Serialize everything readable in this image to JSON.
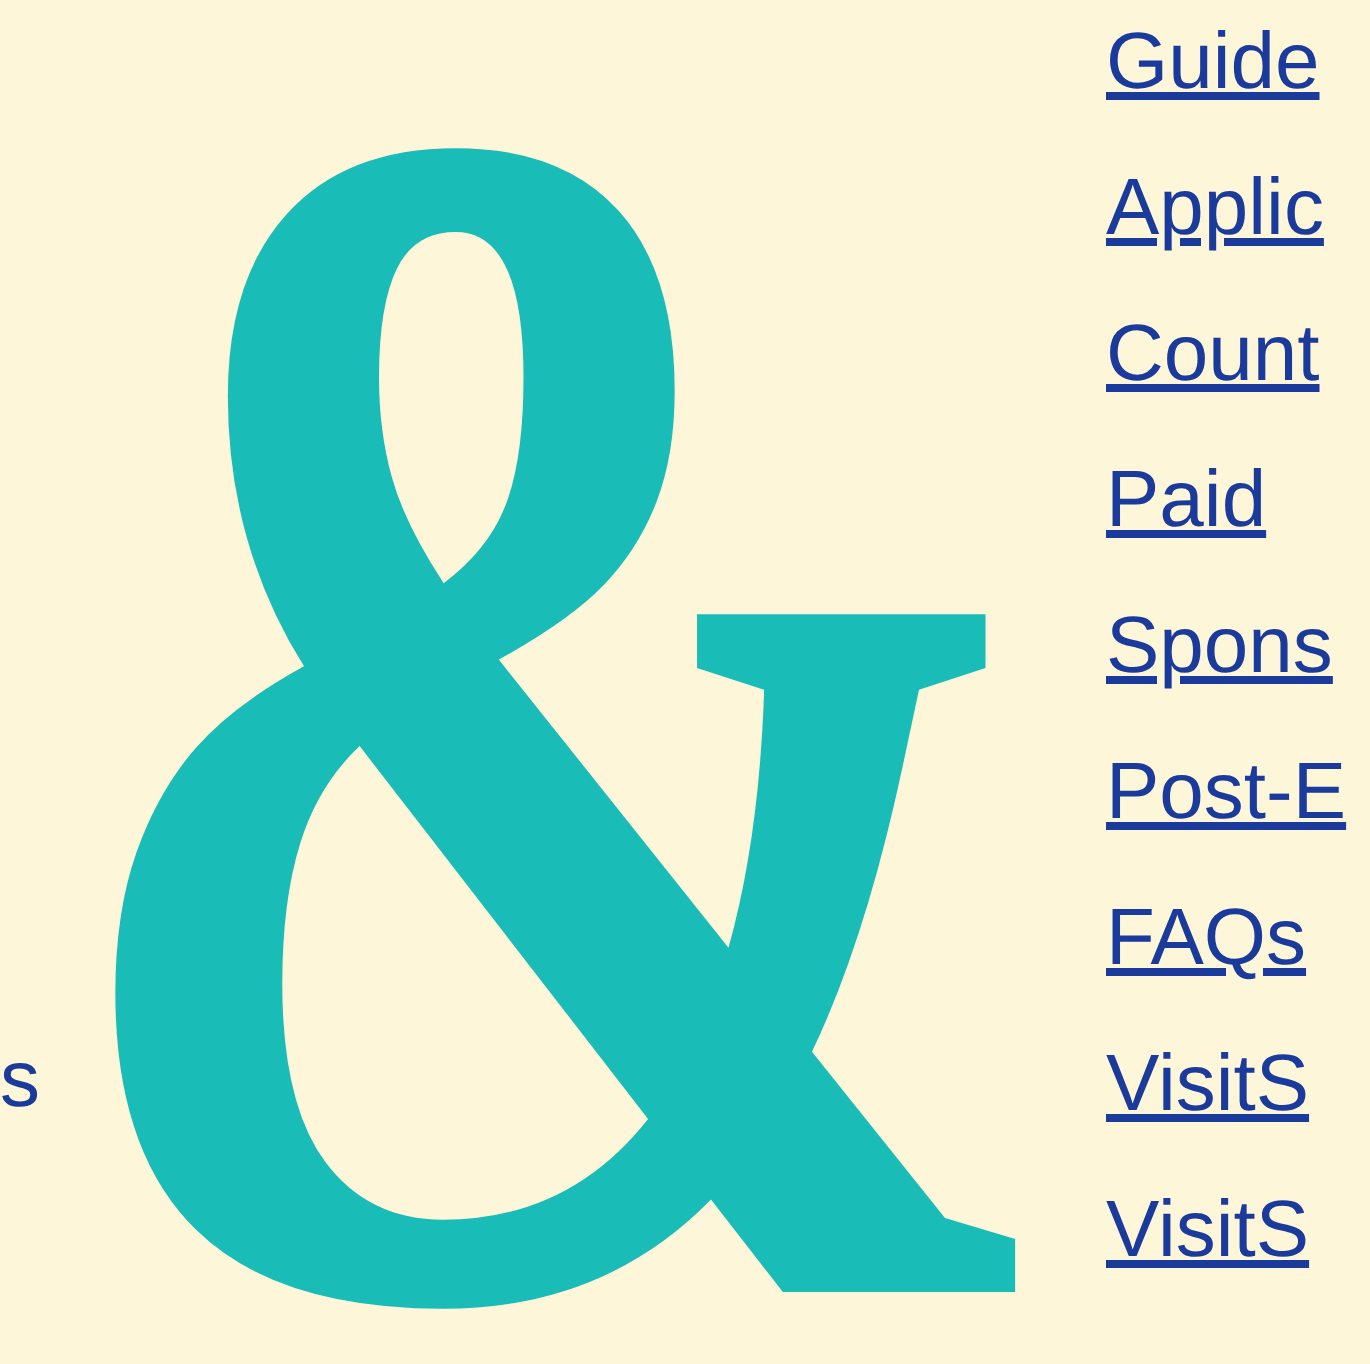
{
  "decoration": {
    "glyph": "&"
  },
  "left_link": {
    "label": "s"
  },
  "links": [
    {
      "label": "Guide"
    },
    {
      "label": "Applic"
    },
    {
      "label": "Count"
    },
    {
      "label": "Paid"
    },
    {
      "label": "Spons"
    },
    {
      "label": "Post-E"
    },
    {
      "label": "FAQs"
    },
    {
      "label": "VisitS"
    },
    {
      "label": "VisitS"
    }
  ]
}
